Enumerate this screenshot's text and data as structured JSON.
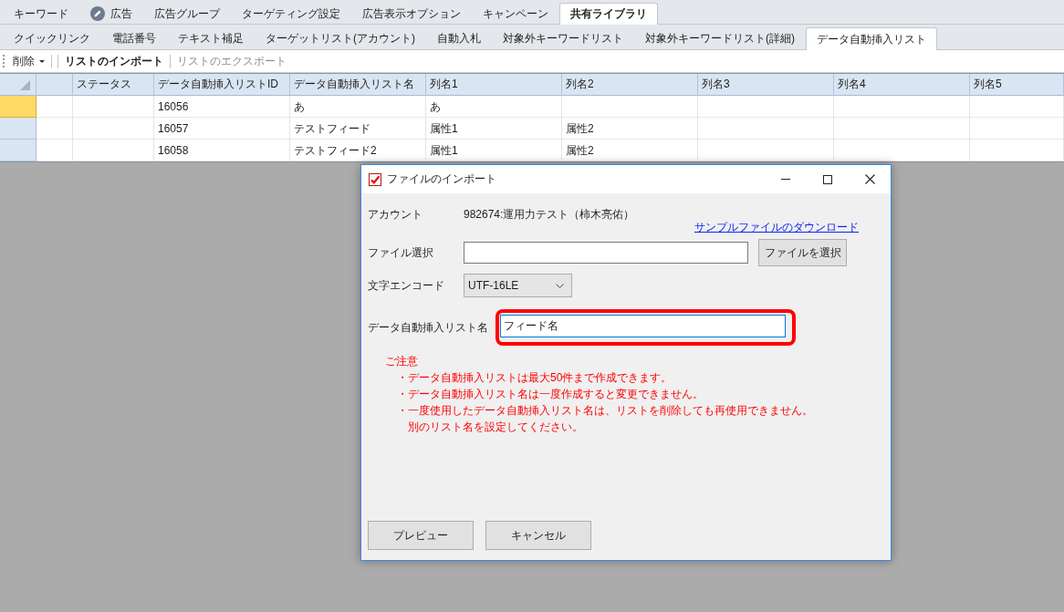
{
  "main_tabs": [
    {
      "label": "キーワード",
      "kind": "text",
      "selected": false
    },
    {
      "label": "広告",
      "kind": "icon",
      "selected": false
    },
    {
      "label": "広告グループ",
      "kind": "text",
      "selected": false
    },
    {
      "label": "ターゲティング設定",
      "kind": "text",
      "selected": false
    },
    {
      "label": "広告表示オプション",
      "kind": "text",
      "selected": false
    },
    {
      "label": "キャンペーン",
      "kind": "text",
      "selected": false
    },
    {
      "label": "共有ライブラリ",
      "kind": "text",
      "selected": true
    }
  ],
  "sub_tabs": [
    {
      "label": "クイックリンク",
      "selected": false
    },
    {
      "label": "電話番号",
      "selected": false
    },
    {
      "label": "テキスト補足",
      "selected": false
    },
    {
      "label": "ターゲットリスト(アカウント)",
      "selected": false
    },
    {
      "label": "自動入札",
      "selected": false
    },
    {
      "label": "対象外キーワードリスト",
      "selected": false
    },
    {
      "label": "対象外キーワードリスト(詳細)",
      "selected": false
    },
    {
      "label": "データ自動挿入リスト",
      "selected": true
    }
  ],
  "toolbar": [
    {
      "kind": "dropdown",
      "label": "削除",
      "disabled": false
    },
    {
      "kind": "button",
      "label": "リストのインポート",
      "disabled": false
    },
    {
      "kind": "button",
      "label": "リストのエクスポート",
      "disabled": true
    }
  ],
  "table": {
    "columns": [
      "ステータス",
      "データ自動挿入リストID",
      "データ自動挿入リスト名",
      "列名1",
      "列名2",
      "列名3",
      "列名4",
      "列名5"
    ],
    "rows": [
      {
        "selected": true,
        "id": "16056",
        "name": "あ",
        "values": [
          "あ"
        ]
      },
      {
        "selected": false,
        "id": "16057",
        "name": "テストフィード",
        "values": [
          "属性1",
          "属性2"
        ]
      },
      {
        "selected": false,
        "id": "16058",
        "name": "テストフィード2",
        "values": [
          "属性1",
          "属性2"
        ]
      }
    ]
  },
  "dialog": {
    "title": "ファイルのインポート",
    "account": {
      "label": "アカウント",
      "value": "982674:運用力テスト（柿木亮佑）"
    },
    "sample_link": "サンプルファイルのダウンロード",
    "file": {
      "label": "ファイル選択",
      "button": "ファイルを選択"
    },
    "encoding": {
      "label": "文字エンコード",
      "value": "UTF-16LE"
    },
    "list_name": {
      "label": "データ自動挿入リスト名",
      "value": "フィード名",
      "focused": true,
      "highlighted": true
    },
    "notice": {
      "title": "ご注意",
      "items": [
        [
          "・データ自動挿入リストは最大50件まで作成できます。"
        ],
        [
          "・データ自動挿入リスト名は一度作成すると変更できません。"
        ],
        [
          "・一度使用したデータ自動挿入リスト名は、リストを削除しても再使用できません。",
          "別のリスト名を設定してください。"
        ]
      ]
    },
    "buttons": [
      "プレビュー",
      "キャンセル"
    ]
  }
}
